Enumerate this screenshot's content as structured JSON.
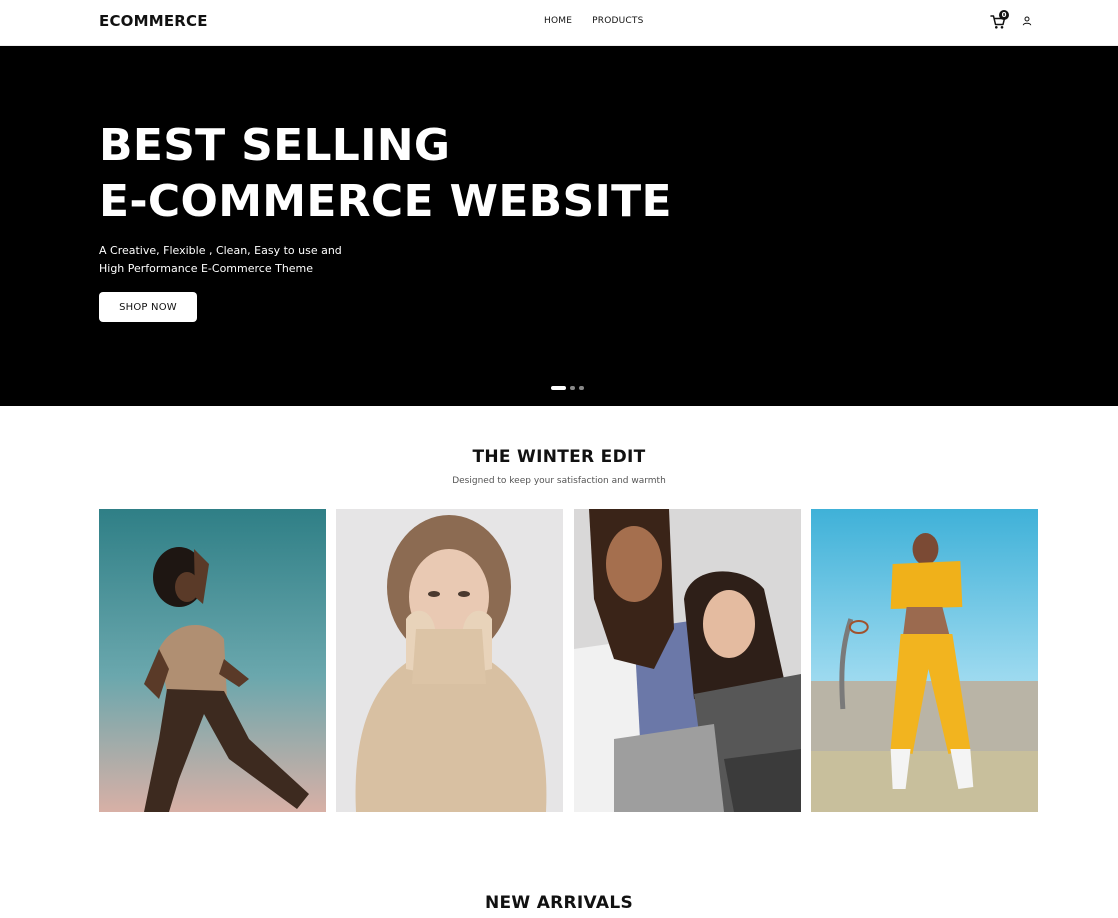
{
  "navbar": {
    "brand": "ECOMMERCE",
    "links": [
      "HOME",
      "PRODUCTS"
    ],
    "cart_count": "0",
    "icons": [
      "cart-icon",
      "user-icon"
    ]
  },
  "hero": {
    "title_lines": [
      "BEST SELLING",
      "E-COMMERCE WEBSITE"
    ],
    "subtitle_lines": [
      "A Creative, Flexible , Clean, Easy to use and",
      "High Performance E-Commerce Theme"
    ],
    "button_label": "SHOP NOW",
    "slides_total": 3,
    "active_slide": 1
  },
  "winter_edit": {
    "title": "THE WINTER EDIT",
    "subtitle": "Designed to keep your satisfaction and warmth",
    "images": [
      "woman-in-snakeskin-shirt-against-sky",
      "woman-in-beige-turtleneck-sweater",
      "couple-in-casual-streetwear",
      "woman-in-yellow-tracksuit-by-basketball-hoop"
    ]
  },
  "new_arrivals": {
    "title": "NEW ARRIVALS"
  },
  "colors": {
    "hero_bg": "#000000",
    "text": "#111111",
    "button_bg": "#ffffff"
  }
}
